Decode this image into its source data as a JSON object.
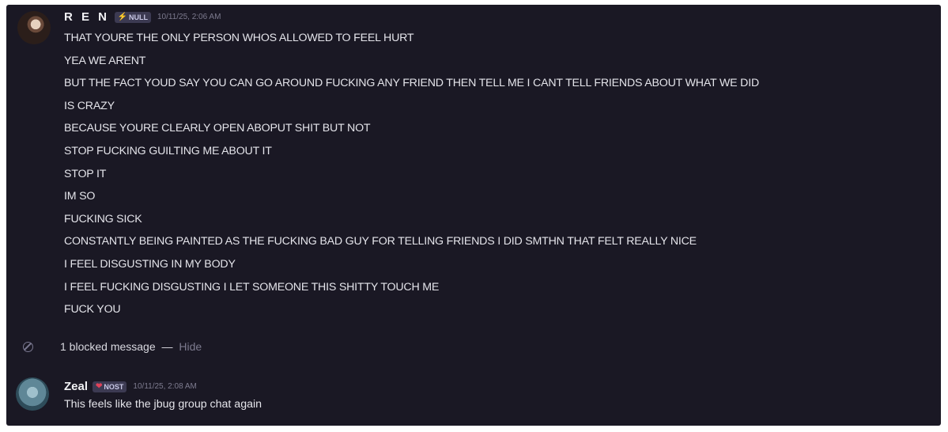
{
  "messages": [
    {
      "author": "R E N",
      "role_tag": "NULL",
      "role_tag_icon": "lightning-bolt-icon",
      "timestamp": "10/11/25, 2:06 AM",
      "lines": [
        "THAT YOURE THE ONLY PERSON WHOS ALLOWED TO FEEL HURT",
        "YEA WE ARENT",
        "BUT THE FACT YOUD SAY YOU CAN GO AROUND FUCKING ANY FRIEND THEN TELL ME I CANT TELL FRIENDS ABOUT WHAT WE DID",
        "IS CRAZY",
        "BECAUSE YOURE CLEARLY OPEN ABOPUT SHIT BUT NOT",
        "STOP FUCKING GUILTING ME ABOUT IT",
        "STOP IT",
        "IM SO",
        "FUCKING SICK",
        "CONSTANTLY BEING PAINTED AS THE FUCKING BAD GUY FOR TELLING FRIENDS I DID SMTHN THAT FELT REALLY NICE",
        "I FEEL DISGUSTING IN MY BODY",
        "I FEEL FUCKING DISGUSTING I LET SOMEONE THIS SHITTY TOUCH ME",
        "FUCK YOU"
      ]
    },
    {
      "author": "Zeal",
      "role_tag": "NOST",
      "role_tag_icon": "heart-icon",
      "timestamp": "10/11/25, 2:08 AM",
      "lines": [
        "This feels like the jbug group chat again"
      ]
    }
  ],
  "blocked": {
    "text": "1 blocked message",
    "separator": "—",
    "hide_label": "Hide"
  },
  "colors": {
    "background": "#1a1824",
    "text": "#e4e4ea",
    "muted": "#7d7b8f"
  }
}
